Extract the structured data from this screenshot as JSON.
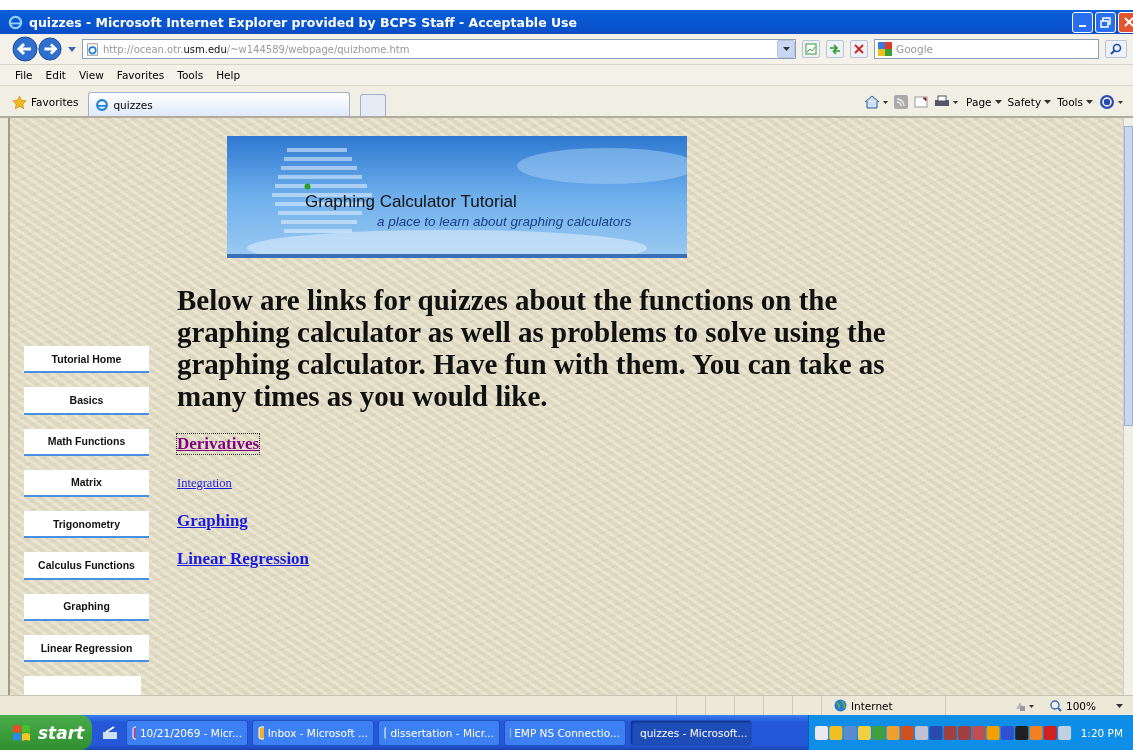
{
  "window": {
    "title": "quizzes - Microsoft Internet Explorer provided by BCPS Staff - Acceptable Use"
  },
  "address_bar": {
    "url": "http://ocean.otr.**usm.edu**/~w144589/webpage/quizhome.htm"
  },
  "search": {
    "placeholder": "Google"
  },
  "menu": [
    "File",
    "Edit",
    "View",
    "Favorites",
    "Tools",
    "Help"
  ],
  "favorites_bar": {
    "favorites": "Favorites",
    "tabs": [
      {
        "label": "quizzes",
        "selected": true
      }
    ]
  },
  "command_bar": [
    "Page",
    "Safety",
    "Tools"
  ],
  "page": {
    "banner": {
      "title": "Graphing Calculator Tutorial",
      "subtitle": "a place to learn about graphing calculators"
    },
    "nav": [
      "Tutorial Home",
      "Basics",
      "Math Functions",
      "Matrix",
      "Trigonometry",
      "Calculus Functions",
      "Graphing",
      "Linear Regression"
    ],
    "heading": "Below are links for quizzes about the functions on the graphing calculator as well as problems to solve using the graphing calculator. Have fun with them. You can take as many times as you would like.",
    "links": [
      {
        "label": "Derivatives",
        "kind": "large",
        "visited": true,
        "focused": true
      },
      {
        "label": "Integration",
        "kind": "small",
        "visited": false,
        "focused": false
      },
      {
        "label": "Graphing",
        "kind": "large",
        "visited": false,
        "focused": false
      },
      {
        "label": "Linear Regression",
        "kind": "large",
        "visited": false,
        "focused": false
      }
    ]
  },
  "status_bar": {
    "zone": "Internet",
    "zoom": "100%"
  },
  "taskbar": {
    "start": "start",
    "tasks": [
      {
        "label": "10/21/2069 - Micr...",
        "selected": false
      },
      {
        "label": "Inbox - Microsoft ...",
        "selected": false
      },
      {
        "label": "dissertation - Micr...",
        "selected": false
      },
      {
        "label": "EMP NS Connectio...",
        "selected": false
      },
      {
        "label": "quizzes - Microsoft...",
        "selected": true
      }
    ],
    "clock": "1:20 PM"
  }
}
